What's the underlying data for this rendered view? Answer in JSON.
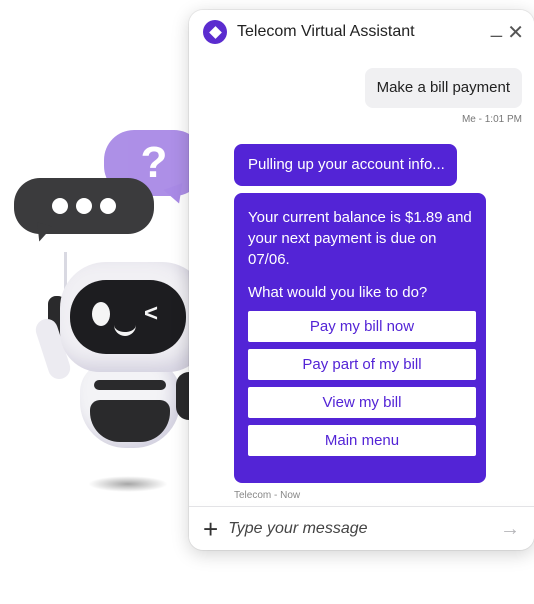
{
  "illustration": {
    "question_mark": "?",
    "dots": [
      "•",
      "•",
      "•"
    ]
  },
  "header": {
    "title": "Telecom Virtual Assistant",
    "minimize_icon": "minimize-icon",
    "close_icon": "close-icon",
    "minimize_glyph": "_",
    "close_glyph": "✕"
  },
  "conversation": {
    "user_message": "Make a bill payment",
    "user_meta": "Me - 1:01 PM",
    "bot_message_1": "Pulling up your account info...",
    "bot_balance_text": "Your current balance is $1.89 and your next payment is due on 07/06.",
    "bot_question": "What would you like to do?",
    "options": [
      "Pay my bill now",
      "Pay part of my bill",
      "View my bill",
      "Main menu"
    ],
    "bot_meta": "Telecom - Now"
  },
  "composer": {
    "placeholder": "Type your message",
    "plus_glyph": "+",
    "send_glyph": "→"
  },
  "colors": {
    "brand": "#5324d6",
    "bubble_purple": "#a98ae6",
    "bubble_dark": "#3b3b3d"
  }
}
